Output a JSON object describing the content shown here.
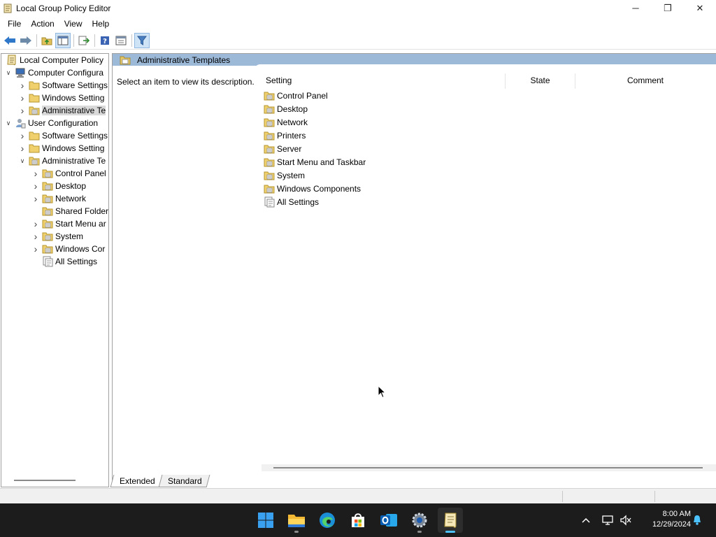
{
  "window": {
    "title": "Local Group Policy Editor",
    "controls": {
      "minimize": "─",
      "maximize": "❐",
      "close": "✕"
    }
  },
  "menu": [
    "File",
    "Action",
    "View",
    "Help"
  ],
  "toolbar": [
    "back-icon",
    "forward-icon",
    "up-folder-icon",
    "show-hide-tree-icon",
    "export-list-icon",
    "help-icon",
    "properties-icon",
    "filter-icon"
  ],
  "tree": [
    {
      "label": "Local Computer Policy",
      "level": 0,
      "expander": "",
      "icon": "policy-icon"
    },
    {
      "label": "Computer Configura",
      "level": 1,
      "expander": "open",
      "icon": "computer-icon"
    },
    {
      "label": "Software Settings",
      "level": 2,
      "expander": "closed",
      "icon": "folder-icon"
    },
    {
      "label": "Windows Setting",
      "level": 2,
      "expander": "closed",
      "icon": "folder-icon"
    },
    {
      "label": "Administrative Te",
      "level": 2,
      "expander": "closed",
      "icon": "policy-folder-icon",
      "selected": true
    },
    {
      "label": "User Configuration",
      "level": 1,
      "expander": "open",
      "icon": "user-icon"
    },
    {
      "label": "Software Settings",
      "level": 2,
      "expander": "closed",
      "icon": "folder-icon"
    },
    {
      "label": "Windows Setting",
      "level": 2,
      "expander": "closed",
      "icon": "folder-icon"
    },
    {
      "label": "Administrative Te",
      "level": 2,
      "expander": "open",
      "icon": "policy-folder-icon"
    },
    {
      "label": "Control Panel",
      "level": 3,
      "expander": "closed",
      "icon": "policy-folder-icon"
    },
    {
      "label": "Desktop",
      "level": 3,
      "expander": "closed",
      "icon": "policy-folder-icon"
    },
    {
      "label": "Network",
      "level": 3,
      "expander": "closed",
      "icon": "policy-folder-icon"
    },
    {
      "label": "Shared Folder",
      "level": 3,
      "expander": "",
      "icon": "policy-folder-icon"
    },
    {
      "label": "Start Menu ar",
      "level": 3,
      "expander": "closed",
      "icon": "policy-folder-icon"
    },
    {
      "label": "System",
      "level": 3,
      "expander": "closed",
      "icon": "policy-folder-icon"
    },
    {
      "label": "Windows Cor",
      "level": 3,
      "expander": "closed",
      "icon": "policy-folder-icon"
    },
    {
      "label": "All Settings",
      "level": 3,
      "expander": "",
      "icon": "all-settings-icon"
    }
  ],
  "details": {
    "header_title": "Administrative Templates",
    "description": "Select an item to view its description.",
    "columns": [
      "Setting",
      "State",
      "Comment"
    ],
    "items": [
      {
        "label": "Control Panel",
        "icon": "policy-folder-icon"
      },
      {
        "label": "Desktop",
        "icon": "policy-folder-icon"
      },
      {
        "label": "Network",
        "icon": "policy-folder-icon"
      },
      {
        "label": "Printers",
        "icon": "policy-folder-icon"
      },
      {
        "label": "Server",
        "icon": "policy-folder-icon"
      },
      {
        "label": "Start Menu and Taskbar",
        "icon": "policy-folder-icon"
      },
      {
        "label": "System",
        "icon": "policy-folder-icon"
      },
      {
        "label": "Windows Components",
        "icon": "policy-folder-icon"
      },
      {
        "label": "All Settings",
        "icon": "all-settings-icon"
      }
    ],
    "tabs": [
      "Extended",
      "Standard"
    ],
    "active_tab": "Extended"
  },
  "taskbar": {
    "apps": [
      "start-icon",
      "file-explorer-icon",
      "edge-icon",
      "store-icon",
      "outlook-icon",
      "settings-icon",
      "group-policy-editor-icon"
    ],
    "tray": [
      "chevron-up-icon",
      "network-icon",
      "volume-muted-icon",
      "notification-icon"
    ],
    "time": "8:00 AM",
    "date": "12/29/2024"
  },
  "colors": {
    "header_band": "#9db9d8",
    "taskbar": "#1c1c1c",
    "accent": "#4cc2ff"
  }
}
